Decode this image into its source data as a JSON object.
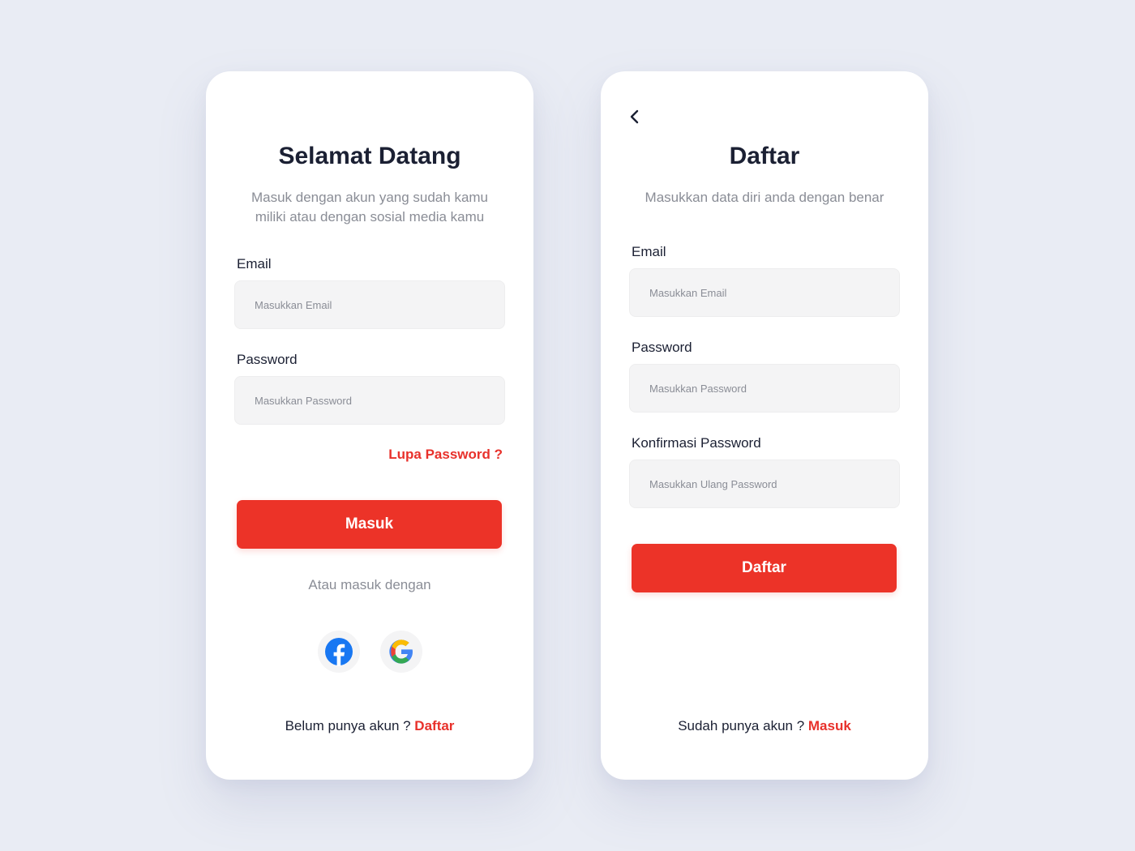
{
  "login": {
    "title": "Selamat Datang",
    "subtitle": "Masuk dengan akun yang sudah kamu miliki atau dengan sosial media kamu",
    "email_label": "Email",
    "email_placeholder": "Masukkan Email",
    "password_label": "Password",
    "password_placeholder": "Masukkan Password",
    "forgot_label": "Lupa Password ?",
    "submit_label": "Masuk",
    "divider_text": "Atau masuk dengan",
    "social": [
      {
        "icon": "facebook-icon",
        "color": "#1877f2"
      },
      {
        "icon": "google-icon",
        "colors": [
          "#4285f4",
          "#34a853",
          "#fbbc05",
          "#ea4335"
        ]
      }
    ],
    "footer_text": "Belum punya akun ? ",
    "footer_link": "Daftar"
  },
  "register": {
    "back_icon": "chevron-left-icon",
    "title": "Daftar",
    "subtitle": "Masukkan data diri anda dengan benar",
    "email_label": "Email",
    "email_placeholder": "Masukkan Email",
    "password_label": "Password",
    "password_placeholder": "Masukkan Password",
    "confirm_label": "Konfirmasi Password",
    "confirm_placeholder": "Masukkan Ulang Password",
    "submit_label": "Daftar",
    "footer_text": "Sudah punya akun ? ",
    "footer_link": "Masuk"
  },
  "colors": {
    "background": "#e9ecf4",
    "card": "#ffffff",
    "accent": "#ec3328",
    "heading": "#1b2033",
    "muted": "#8a8d96",
    "input_bg": "#f4f4f5"
  }
}
